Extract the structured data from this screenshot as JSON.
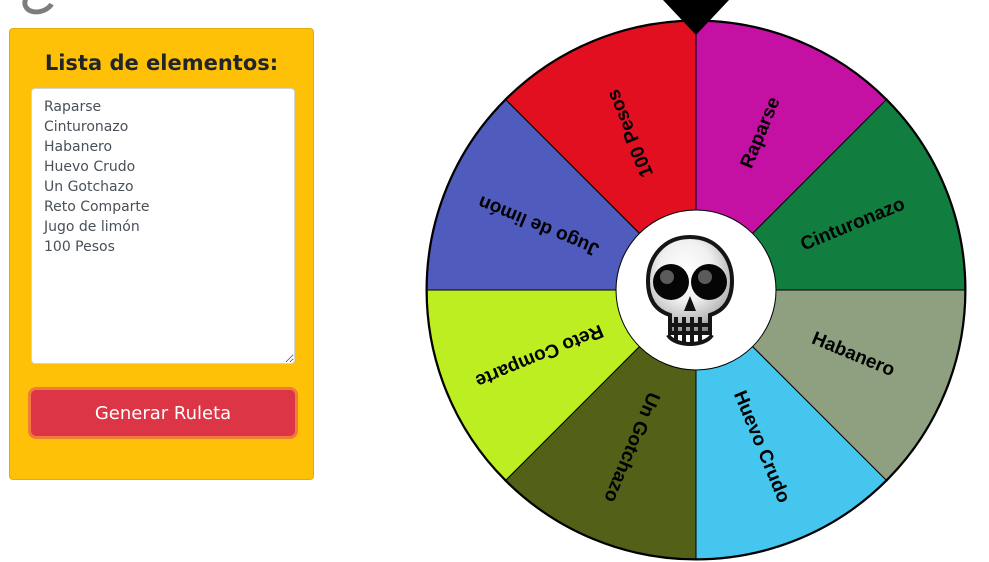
{
  "panel": {
    "title": "Lista de elementos:",
    "textarea_value": "Raparse\nCinturonazo\nHabanero\nHuevo Crudo\nUn Gotchazo\nReto Comparte\nJugo de limón\n100 Pesos",
    "button_label": "Generar Ruleta",
    "background_color": "#ffc107",
    "button_color": "#dc3545"
  },
  "wheel": {
    "segments": [
      {
        "label": "100 Pesos",
        "color": "#e10f1f"
      },
      {
        "label": "Raparse",
        "color": "#c511a3"
      },
      {
        "label": "Cinturonazo",
        "color": "#117d3f"
      },
      {
        "label": "Habanero",
        "color": "#8fa080"
      },
      {
        "label": "Huevo Crudo",
        "color": "#45c6ee"
      },
      {
        "label": "Un Gotchazo",
        "color": "#526018"
      },
      {
        "label": "Reto Comparte",
        "color": "#bcee22"
      },
      {
        "label": "Jugo de limón",
        "color": "#4f5bbd"
      }
    ],
    "center_icon": "skull-icon",
    "pointer_icon": "pointer-icon",
    "pointer_color": "#000000",
    "center_color": "#ffffff"
  }
}
